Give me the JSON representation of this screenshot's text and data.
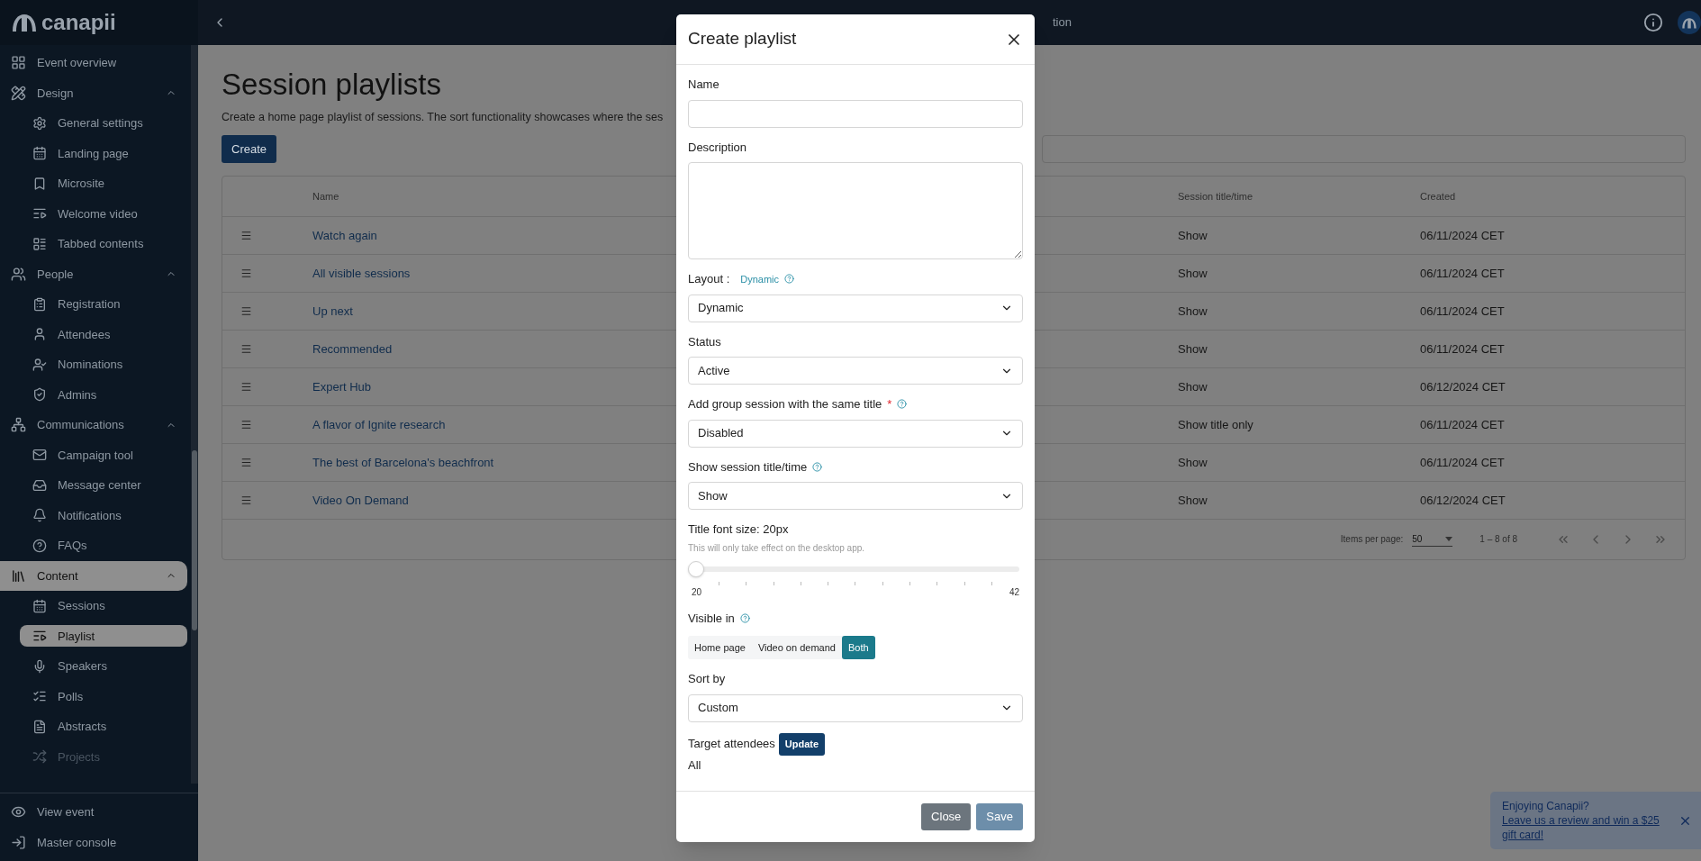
{
  "brand": "canapii",
  "sidebar": {
    "sections": [
      {
        "label": "Event overview",
        "selected": false
      },
      {
        "label": "Design",
        "selected": false,
        "expanded": true,
        "children": [
          {
            "label": "General settings",
            "selected": false,
            "disabled": false
          },
          {
            "label": "Landing page",
            "selected": false,
            "disabled": false
          },
          {
            "label": "Microsite",
            "selected": false,
            "disabled": false
          },
          {
            "label": "Welcome video",
            "selected": false,
            "disabled": false
          },
          {
            "label": "Tabbed contents",
            "selected": false,
            "disabled": false
          }
        ]
      },
      {
        "label": "People",
        "selected": false,
        "expanded": true,
        "children": [
          {
            "label": "Registration",
            "selected": false,
            "disabled": false
          },
          {
            "label": "Attendees",
            "selected": false,
            "disabled": false
          },
          {
            "label": "Nominations",
            "selected": false,
            "disabled": false
          },
          {
            "label": "Admins",
            "selected": false,
            "disabled": false
          }
        ]
      },
      {
        "label": "Communications",
        "selected": false,
        "expanded": true,
        "children": [
          {
            "label": "Campaign tool",
            "selected": false,
            "disabled": false
          },
          {
            "label": "Message center",
            "selected": false,
            "disabled": false
          },
          {
            "label": "Notifications",
            "selected": false,
            "disabled": false
          },
          {
            "label": "FAQs",
            "selected": false,
            "disabled": false
          }
        ]
      },
      {
        "label": "Content",
        "selected": true,
        "expanded": true,
        "children": [
          {
            "label": "Sessions",
            "selected": false,
            "disabled": false
          },
          {
            "label": "Playlist",
            "selected": true,
            "disabled": false
          },
          {
            "label": "Speakers",
            "selected": false,
            "disabled": false
          },
          {
            "label": "Polls",
            "selected": false,
            "disabled": false
          },
          {
            "label": "Abstracts",
            "selected": false,
            "disabled": false
          },
          {
            "label": "Projects",
            "selected": false,
            "disabled": true
          }
        ]
      }
    ],
    "footer_items": [
      "View event",
      "Master console"
    ]
  },
  "header": {
    "title_fragment": "tion"
  },
  "page": {
    "title": "Session playlists",
    "description": "Create a home page playlist of sessions. The sort functionality showcases where the ses",
    "create_button": "Create"
  },
  "table": {
    "columns": [
      "Name",
      "Session title/time",
      "Created"
    ],
    "rows": [
      {
        "name": "Watch again",
        "session_title_time": "Show",
        "created": "06/11/2024 CET"
      },
      {
        "name": "All visible sessions",
        "session_title_time": "Show",
        "created": "06/11/2024 CET"
      },
      {
        "name": "Up next",
        "session_title_time": "Show",
        "created": "06/11/2024 CET"
      },
      {
        "name": "Recommended",
        "session_title_time": "Show",
        "created": "06/11/2024 CET"
      },
      {
        "name": "Expert Hub",
        "session_title_time": "Show",
        "created": "06/12/2024 CET"
      },
      {
        "name": "A flavor of Ignite research",
        "session_title_time": "Show title only",
        "created": "06/11/2024 CET"
      },
      {
        "name": "The best of Barcelona's beachfront",
        "session_title_time": "Show",
        "created": "06/11/2024 CET"
      },
      {
        "name": "Video On Demand",
        "session_title_time": "Show",
        "created": "06/12/2024 CET"
      }
    ],
    "paginator": {
      "items_per_page_label": "Items per page:",
      "items_per_page": "50",
      "range": "1 – 8 of 8"
    }
  },
  "dialog": {
    "title": "Create playlist",
    "fields": [
      {
        "kind": "text",
        "label": "Name"
      },
      {
        "kind": "textarea",
        "label": "Description"
      },
      {
        "kind": "select",
        "label": "Layout :",
        "label_link": "Dynamic",
        "help": true,
        "value": "Dynamic"
      },
      {
        "kind": "select",
        "label": "Status",
        "value": "Active"
      },
      {
        "kind": "select",
        "label": "Add group session with the same title",
        "required_mark": "*",
        "help": true,
        "value": "Disabled"
      },
      {
        "kind": "select",
        "label": "Show session title/time",
        "help": true,
        "value": "Show"
      },
      {
        "kind": "slider",
        "label": "Title font size: 20px",
        "hint": "This will only take effect on the desktop app.",
        "level": 0,
        "min": "20",
        "max": "42"
      },
      {
        "kind": "segmented",
        "label": "Visible in",
        "help": true,
        "options": [
          {
            "label": "Home page",
            "selected": false
          },
          {
            "label": "Video on demand",
            "selected": false
          },
          {
            "label": "Both",
            "selected": true
          }
        ]
      },
      {
        "kind": "select",
        "label": "Sort by",
        "value": "Custom"
      },
      {
        "kind": "target",
        "label": "Target attendees",
        "button": "Update",
        "value": "All"
      }
    ],
    "buttons": [
      {
        "label": "Close",
        "kind": "secondary"
      },
      {
        "label": "Save",
        "kind": "primary"
      }
    ]
  },
  "toast": {
    "text": "Enjoying Canapii? ",
    "link": "Leave us a review and win a $25 gift card!"
  }
}
